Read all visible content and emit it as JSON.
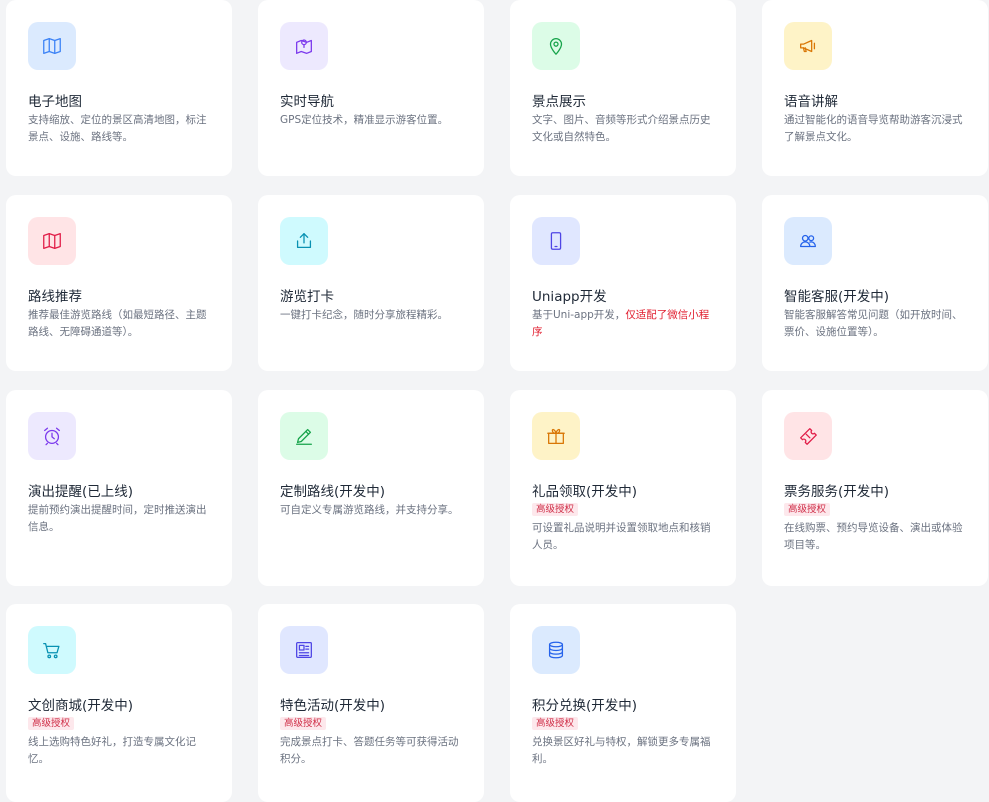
{
  "features": [
    {
      "title": "电子地图",
      "desc": "支持缩放、定位的景区高清地图，标注景点、设施、路线等。",
      "icon": "map-icon"
    },
    {
      "title": "实时导航",
      "desc": "GPS定位技术，精准显示游客位置。",
      "icon": "navigation-map-icon"
    },
    {
      "title": "景点展示",
      "desc": "文字、图片、音频等形式介绍景点历史文化或自然特色。",
      "icon": "location-pin-icon"
    },
    {
      "title": "语音讲解",
      "desc": "通过智能化的语音导览帮助游客沉浸式了解景点文化。",
      "icon": "megaphone-icon"
    },
    {
      "title": "路线推荐",
      "desc": "推荐最佳游览路线（如最短路径、主题路线、无障碍通道等）。",
      "icon": "folded-map-icon"
    },
    {
      "title": "游览打卡",
      "desc": "一键打卡纪念，随时分享旅程精彩。",
      "icon": "share-upload-icon"
    },
    {
      "title": "Uniapp开发",
      "desc_prefix": "基于Uni-app开发，",
      "desc_highlight": "仅适配了微信小程序",
      "icon": "mobile-phone-icon"
    },
    {
      "title": "智能客服(开发中)",
      "desc": "智能客服解答常见问题（如开放时间、票价、设施位置等）。",
      "icon": "users-icon"
    },
    {
      "title": "演出提醒(已上线)",
      "desc": "提前预约演出提醒时间，定时推送演出信息。",
      "icon": "alarm-clock-icon"
    },
    {
      "title": "定制路线(开发中)",
      "desc": "可自定义专属游览路线，并支持分享。",
      "icon": "pencil-edit-icon"
    },
    {
      "title": "礼品领取(开发中)",
      "badge": "高级授权",
      "desc": "可设置礼品说明并设置领取地点和核销人员。",
      "icon": "gift-icon"
    },
    {
      "title": "票务服务(开发中)",
      "badge": "高级授权",
      "desc": "在线购票、预约导览设备、演出或体验项目等。",
      "icon": "ticket-icon"
    },
    {
      "title": "文创商城(开发中)",
      "badge": "高级授权",
      "desc": "线上选购特色好礼，打造专属文化记忆。",
      "icon": "shopping-cart-icon"
    },
    {
      "title": "特色活动(开发中)",
      "badge": "高级授权",
      "desc": "完成景点打卡、答题任务等可获得活动积分。",
      "icon": "newspaper-icon"
    },
    {
      "title": "积分兑换(开发中)",
      "badge": "高级授权",
      "desc": "兑换景区好礼与特权，解锁更多专属福利。",
      "icon": "coins-stack-icon"
    }
  ],
  "colors": {
    "map": "#dbeafe",
    "nav": "#ede9fe",
    "pin": "#dcfce7",
    "speaker": "#fef3c7",
    "route": "#ffe4e6",
    "checkin": "#cffafe",
    "phone": "#e0e7ff",
    "service": "#dbeafe",
    "alarm": "#ede9fe",
    "edit": "#dcfce7",
    "gift": "#fef3c7",
    "ticket": "#ffe4e6",
    "cart": "#cffafe",
    "news": "#e0e7ff",
    "coins": "#dbeafe"
  }
}
